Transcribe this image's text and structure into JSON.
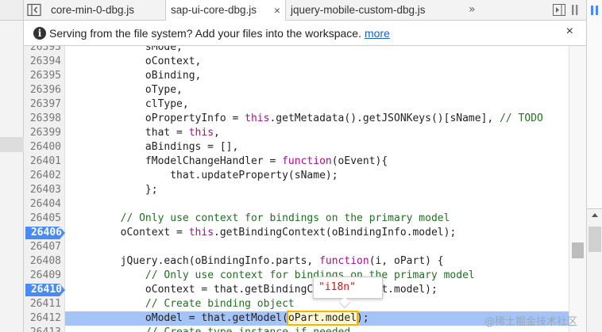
{
  "tabs": [
    {
      "label": "core-min-0-dbg.js",
      "active": false
    },
    {
      "label": "sap-ui-core-dbg.js",
      "active": true
    },
    {
      "label": "jquery-mobile-custom-dbg.js",
      "active": false
    }
  ],
  "tab_overflow": "»",
  "tab_close_glyph": "×",
  "infobar": {
    "message": "Serving from the file system? Add your files into the workspace.",
    "link": "more",
    "close": "×",
    "icon_glyph": "i"
  },
  "code_lines": [
    {
      "n": "26393",
      "text": "            sMode,"
    },
    {
      "n": "26394",
      "text": "            oContext,"
    },
    {
      "n": "26395",
      "text": "            oBinding,"
    },
    {
      "n": "26396",
      "text": "            oType,"
    },
    {
      "n": "26397",
      "text": "            clType,"
    },
    {
      "n": "26398",
      "text": "            oPropertyInfo = this.getMetadata().getJSONKeys()[sName], // TODO"
    },
    {
      "n": "26399",
      "text": "            that = this,"
    },
    {
      "n": "26400",
      "text": "            aBindings = [],"
    },
    {
      "n": "26401",
      "text": "            fModelChangeHandler = function(oEvent){"
    },
    {
      "n": "26402",
      "text": "                that.updateProperty(sName);"
    },
    {
      "n": "26403",
      "text": "            };"
    },
    {
      "n": "26404",
      "text": ""
    },
    {
      "n": "26405",
      "text": "        // Only use context for bindings on the primary model"
    },
    {
      "n": "26406",
      "text": "        oContext = this.getBindingContext(oBindingInfo.model);"
    },
    {
      "n": "26407",
      "text": ""
    },
    {
      "n": "26408",
      "text": "        jQuery.each(oBindingInfo.parts, function(i, oPart) {"
    },
    {
      "n": "26409",
      "text": "            // Only use context for bindings on the primary model"
    },
    {
      "n": "26410",
      "text": "            oContext = that.getBindingContext(oPart.model);"
    },
    {
      "n": "26411",
      "text": "            // Create binding object"
    },
    {
      "n": "26412",
      "text": "            oModel = that.getModel(oPart.model);"
    },
    {
      "n": "26413",
      "text": "            // Create type instance if needed"
    }
  ],
  "breakpoint_lines": [
    "26406",
    "26410"
  ],
  "execution_line": "26412",
  "popover_value": "\"i18n\"",
  "highlighted_expression": "oPart.model",
  "watermark": "@稀土掘金技术社区",
  "colors": {
    "breakpoint": "#4a8af4",
    "execution_highlight": "#a4c4f8",
    "keyword": "#aa0d91",
    "comment": "#236e25",
    "string": "#c41a16",
    "link": "#1a5fc8"
  }
}
